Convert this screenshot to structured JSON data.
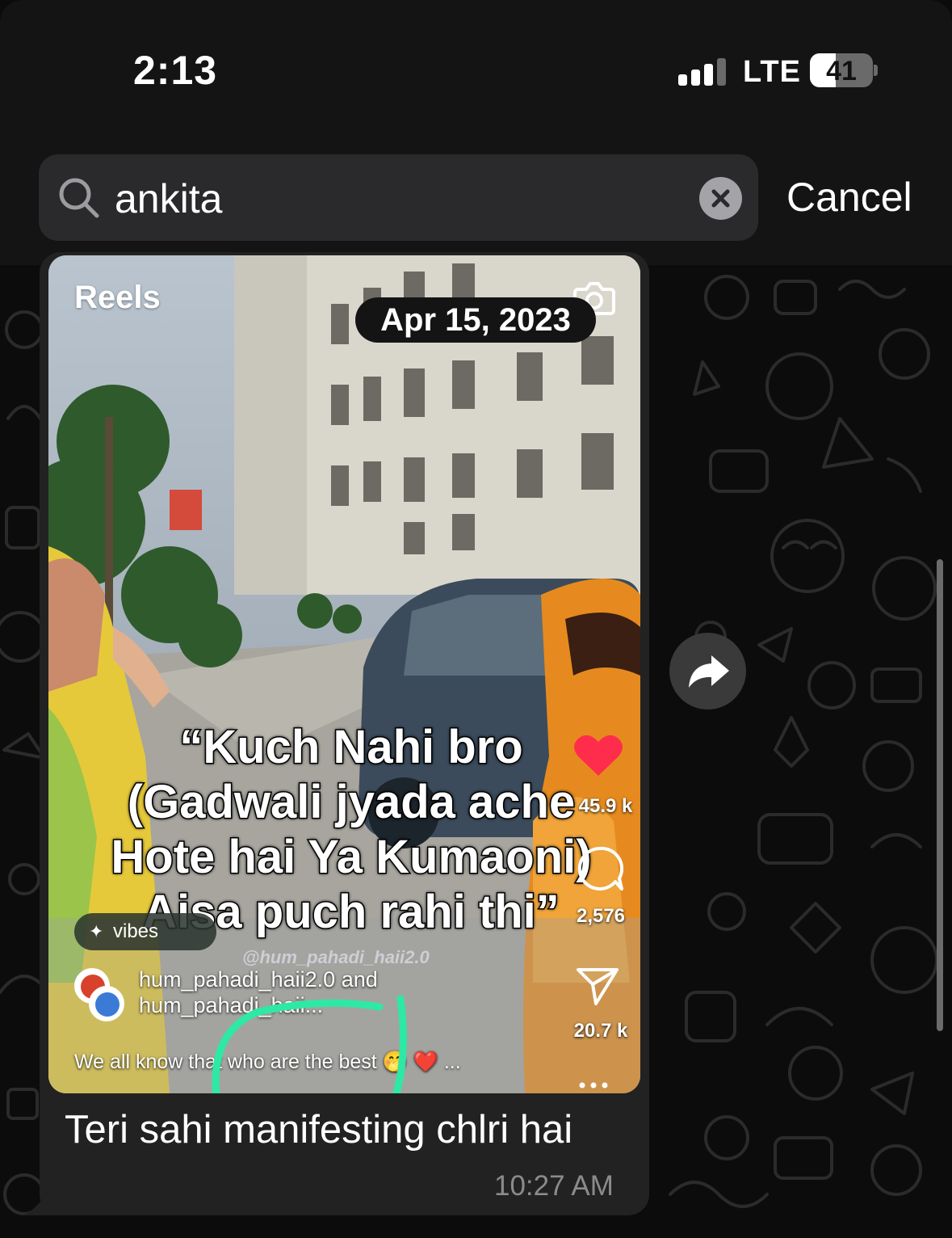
{
  "status_bar": {
    "time": "2:13",
    "network": "LTE",
    "battery": "41",
    "battery_level": 0.41,
    "signal_bars_active": 3
  },
  "search": {
    "value": "ankita",
    "icon": "search-icon",
    "clear_icon": "clear-icon",
    "cancel_label": "Cancel"
  },
  "message": {
    "reel": {
      "source_label": "Reels",
      "date": "Apr 15, 2023",
      "caption_lines": [
        "“Kuch Nahi bro",
        "(Gadwali jyada ache",
        "Hote hai Ya Kumaoni)",
        "Aisa puch rahi thi”"
      ],
      "likes": "45.9 k",
      "comments": "2,576",
      "shares": "20.7 k",
      "audio": "vibes",
      "watermark": "@hum_pahadi_haii2.0",
      "author_primary": "hum_pahadi_haii2.0",
      "author_joiner": "and",
      "author_secondary": "hum_pahadi_haii...",
      "description": "We all know that who are the best 🤭 ❤️  ...",
      "heart_color": "#ff2d4b",
      "scribble_color": "#2ee8a6"
    },
    "text": "Teri sahi manifesting chlri hai",
    "time": "10:27 AM"
  },
  "colors": {
    "background": "#0b0b0b",
    "header": "#141414",
    "bubble": "#222222",
    "search_field": "#2a2a2c",
    "timestamp": "#8b8b8b"
  }
}
